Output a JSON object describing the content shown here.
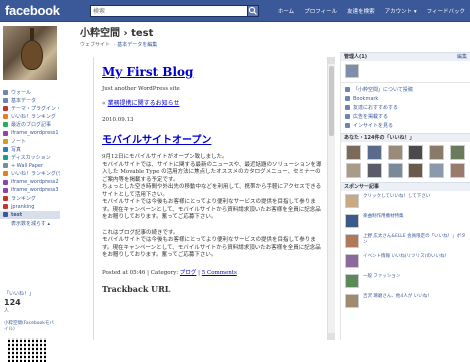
{
  "topbar": {
    "logo": "facebook",
    "search_placeholder": "検索",
    "nav": [
      "ホーム",
      "プロフィール",
      "友達を検索",
      "アカウント ▾",
      "フィードバック"
    ]
  },
  "page": {
    "title": "小粋空間 › test",
    "sub_label": "ウェブサイト",
    "edit_link": "基本データを編集"
  },
  "sidebar": {
    "items": [
      {
        "label": "ウォール",
        "color": "#6d84b4"
      },
      {
        "label": "基本データ",
        "color": "#6d84b4"
      },
      {
        "label": "テーマ・プラグイン・機能",
        "color": "#c0392b"
      },
      {
        "label": "いいね！ランキング",
        "color": "#e67e22"
      },
      {
        "label": "最近のブログ記事",
        "color": "#27ae60"
      },
      {
        "label": "iframe_wordpress1",
        "color": "#8e44ad"
      },
      {
        "label": "ノート",
        "color": "#d4a017"
      },
      {
        "label": "写真",
        "color": "#2980b9"
      },
      {
        "label": "ディスカッション",
        "color": "#16a085"
      },
      {
        "label": "+ Wall Paper",
        "color": "#7f8c8d"
      },
      {
        "label": "いいね！ランキング(デバッグ用)",
        "color": "#e67e22"
      },
      {
        "label": "iframe_wordpress2",
        "color": "#8e44ad"
      },
      {
        "label": "iframe_wordpress3",
        "color": "#8e44ad"
      },
      {
        "label": "ランキング",
        "color": "#c0392b"
      },
      {
        "label": "jpranking",
        "color": "#c0392b"
      },
      {
        "label": "test",
        "color": "#3b5998"
      },
      {
        "label": "表示数を減らす ▴",
        "color": "#ffffff"
      }
    ]
  },
  "fans": {
    "label": "「いいね！」",
    "count": "124",
    "unit": "人",
    "mobile_link": "小粋空間(Facebookモバイル)"
  },
  "blog": {
    "title": "My First Blog",
    "tagline": "Just another WordPress site",
    "prev_prefix": "« ",
    "prev_link": "業務提携に関するお知らせ",
    "date": "2010.09.13",
    "post_title": "モバイルサイトオープン",
    "para1": "9月12日にモバイルサイトがオープン致しました。\nモバイルサイトでは、サイトに関する最新のニュースや、最近話題のソリューションを導入した Movable Type の活用方法に焦点したオススメのカタログメニュー、セミナーのご案内等を掲載する予定です。\nちょっとした空き時間や外出先の移動中などを利用して、携帯から手軽にアクセスできるサイトとして活用下さい。\nモバイルサイトでは今後もお客様にとってより便利なサービスの提供を目指して参ります。現在キャンペーンとして、モバイルサイトから資料請求頂いたお客様を全員に記念品をお贈りしております。奮ってご応募下さい。",
    "para2": "これはブログ記事の続きです。\nモバイルサイトでは今後もお客様にとってより便利なサービスの提供を目指して参ります。現在キャンペーンとして、モバイルサイトから資料請求頂いたお客様を全員に記念品をお贈りしております。奮ってご応募下さい。",
    "meta_prefix": "Posted at 05:46 | Category: ",
    "meta_category": "ブログ",
    "meta_sep": " | ",
    "meta_comments": "5 Comments",
    "trackback": "Trackback URL"
  },
  "right": {
    "admin_header": "管理人(1)",
    "edit": "編集",
    "actions": [
      "「小粋空間」について投稿",
      "Bookmark",
      "友達におすすめする",
      "広告を掲載する",
      "インサイトを見る"
    ],
    "fans_header": "あなた・124件の「いいね！」",
    "fan_names": [
      "",
      "",
      "",
      "",
      "",
      "",
      "",
      "",
      "",
      "",
      "",
      ""
    ],
    "ads_header": "スポンサー記事",
    "ads": [
      "クリックしていいね！して下さい",
      "楽曲制作用機材特集",
      "上野 広太さん&ELLE 会員限定の「いいね！」ボタン",
      "イベント情報 いいね(リツリス)のいいね！",
      "一般 ファッション",
      "吉沢 琢磨さん、他4人が いいね！"
    ]
  }
}
